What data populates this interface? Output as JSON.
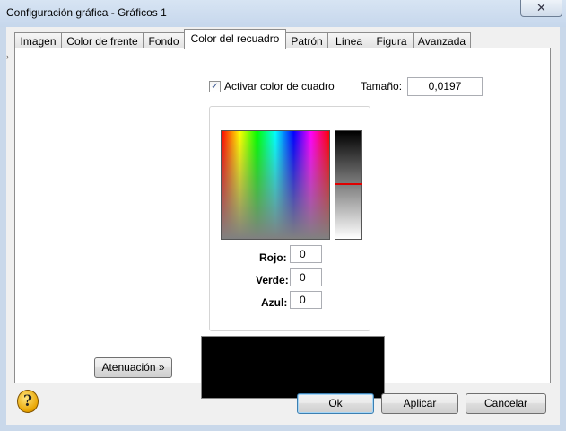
{
  "window": {
    "title": "Configuración gráfica - Gráficos 1",
    "close_label": "✕"
  },
  "tabs": [
    {
      "label": "Imagen"
    },
    {
      "label": "Color de frente"
    },
    {
      "label": "Fondo"
    },
    {
      "label": "Color del recuadro",
      "active": true
    },
    {
      "label": "Patrón"
    },
    {
      "label": "Línea"
    },
    {
      "label": "Figura"
    },
    {
      "label": "Avanzada"
    }
  ],
  "border": {
    "enable_label": "Activar color de cuadro",
    "enable_checked": true,
    "check_glyph": "✓",
    "size_label": "Tamaño:",
    "size_value": "0,0197"
  },
  "rgb": {
    "red_label": "Rojo:",
    "red_value": "0",
    "green_label": "Verde:",
    "green_value": "0",
    "blue_label": "Azul:",
    "blue_value": "0"
  },
  "colors": {
    "selected": "#000000",
    "luminance_marker": "#e00000"
  },
  "buttons": {
    "attenuation": "Atenuación »",
    "ok": "Ok",
    "apply": "Aplicar",
    "cancel": "Cancelar",
    "help_glyph": "?"
  },
  "side_marker": "›"
}
